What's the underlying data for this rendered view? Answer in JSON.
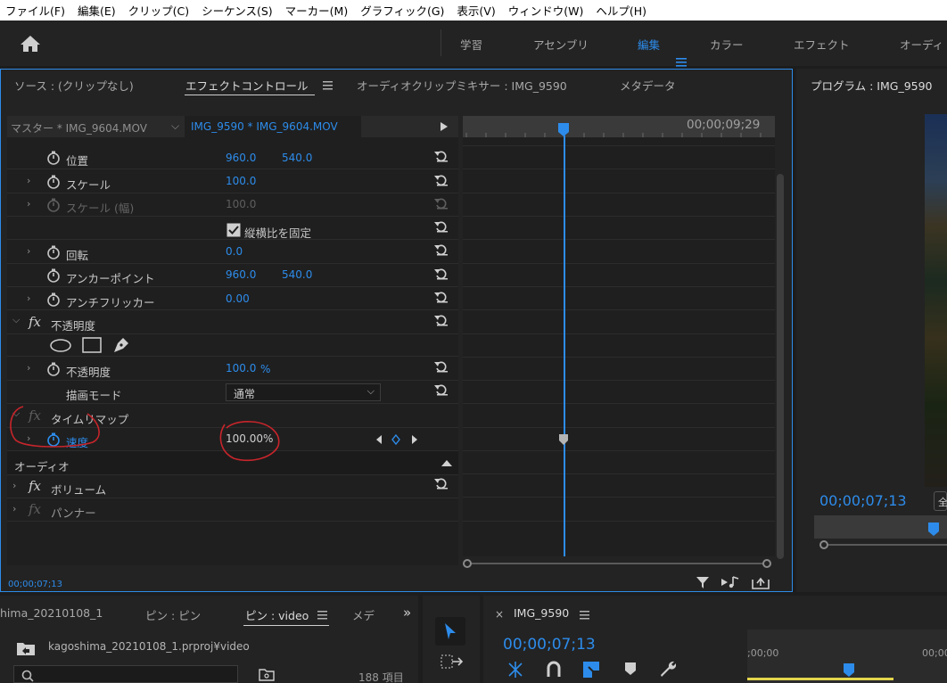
{
  "menu": [
    "ファイル(F)",
    "編集(E)",
    "クリップ(C)",
    "シーケンス(S)",
    "マーカー(M)",
    "グラフィック(G)",
    "表示(V)",
    "ウィンドウ(W)",
    "ヘルプ(H)"
  ],
  "workspaces": [
    "学習",
    "アセンブリ",
    "編集",
    "カラー",
    "エフェクト",
    "オーディ"
  ],
  "panel_tabs": {
    "source": "ソース : (クリップなし)",
    "effect_controls": "エフェクトコントロール",
    "audio_mixer": "オーディオクリップミキサー : IMG_9590",
    "metadata": "メタデータ"
  },
  "clip_header": {
    "master": "マスター * IMG_9604.MOV",
    "sequence": "IMG_9590 * IMG_9604.MOV"
  },
  "timeline_timecode": "00;00;09;29",
  "rows": {
    "position": {
      "label": "位置",
      "x": "960.0",
      "y": "540.0"
    },
    "scale": {
      "label": "スケール",
      "value": "100.0"
    },
    "scale_width": {
      "label": "スケール (幅)",
      "value": "100.0"
    },
    "uniform_scale": "縦横比を固定",
    "rotation": {
      "label": "回転",
      "value": "0.0"
    },
    "anchor": {
      "label": "アンカーポイント",
      "x": "960.0",
      "y": "540.0"
    },
    "flicker": {
      "label": "アンチフリッカー",
      "value": "0.00"
    },
    "opacity_group": "不透明度",
    "opacity": {
      "label": "不透明度",
      "value": "100.0",
      "unit": "%"
    },
    "blend_mode": {
      "label": "描画モード",
      "value": "通常"
    },
    "time_remap": "タイムリマップ",
    "speed": {
      "label": "速度",
      "value": "100.00%"
    },
    "audio": "オーディオ",
    "volume": "ボリューム",
    "panner": "パンナー"
  },
  "ec_timecode": "00;00;07;13",
  "program": {
    "title": "プログラム : IMG_9590",
    "timecode": "00;00;07;13",
    "fit_label": "全"
  },
  "project": {
    "tab_project": "hima_20210108_1",
    "tab_bin": "ピン : ピン",
    "tab_bin_video": "ピン : video",
    "tab_more": "メデ",
    "path": "kagoshima_20210108_1.prproj¥video",
    "count": "188 項目"
  },
  "timeline": {
    "name": "IMG_9590",
    "timecode": "00;00;07;13",
    "ruler_start": ";00;00",
    "ruler_end": "00;00"
  },
  "colors": {
    "accent": "#2d8ceb",
    "panel": "#232323",
    "annotation": "#c8252b"
  }
}
